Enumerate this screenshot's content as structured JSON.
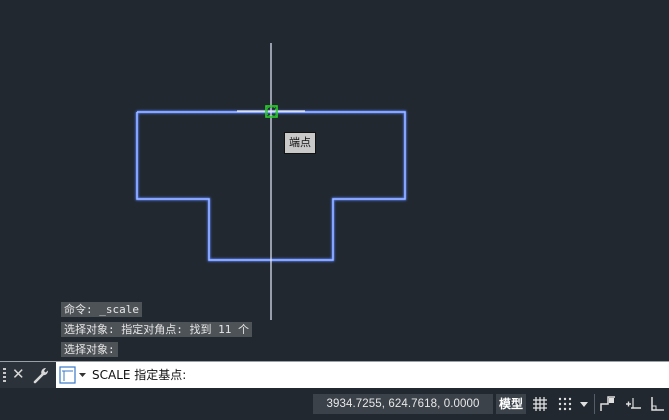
{
  "tooltip": {
    "label": "端点"
  },
  "command_history": [
    "命令: _scale",
    "选择对象: 指定对角点: 找到 11 个",
    "选择对象:"
  ],
  "command_line": {
    "current_prompt": "SCALE 指定基点:"
  },
  "status_bar": {
    "coordinates": "3934.7255, 624.7618, 0.0000",
    "model_label": "模型",
    "icons": [
      "grid-icon",
      "snap-grid-icon",
      "dropdown-arrow-icon",
      "infer-constraints-icon",
      "dynamic-input-icon",
      "ortho-mode-icon"
    ]
  },
  "colors": {
    "background": "#212830",
    "geometry": "#5b86ff",
    "osnap_marker": "#2bd12b",
    "crosshair": "#ffffff"
  }
}
